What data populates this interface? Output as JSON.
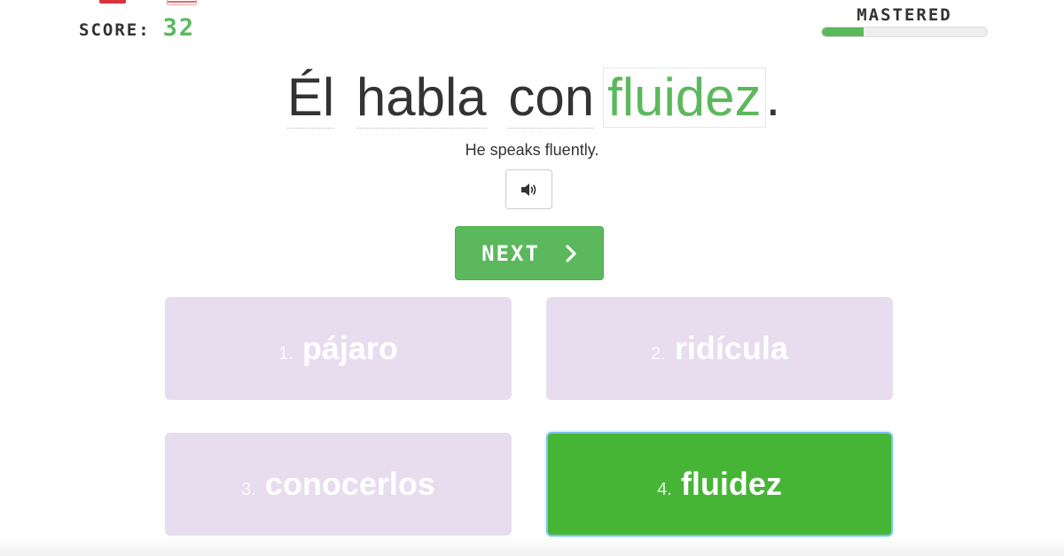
{
  "header": {
    "score_label": "SCORE:",
    "score_value": "32",
    "mastered_label": "MASTERED",
    "mastered_progress": 0.25
  },
  "sentence": {
    "words": [
      "Él",
      "habla",
      "con"
    ],
    "answer": "fluidez",
    "punctuation": ".",
    "translation": "He speaks fluently."
  },
  "controls": {
    "audio_icon": "speaker-icon",
    "next_label": "NEXT",
    "next_icon": "chevron-right-icon"
  },
  "choices": [
    {
      "number": "1.",
      "word": "pájaro",
      "state": "disabled"
    },
    {
      "number": "2.",
      "word": "ridícula",
      "state": "disabled"
    },
    {
      "number": "3.",
      "word": "conocerlos",
      "state": "disabled"
    },
    {
      "number": "4.",
      "word": "fluidez",
      "state": "correct"
    }
  ],
  "colors": {
    "accent_green": "#5cb85c",
    "correct_green": "#46b535",
    "disabled_choice": "#e8dcef",
    "selected_outline": "#7ec4ea",
    "text_dark": "#333333"
  }
}
